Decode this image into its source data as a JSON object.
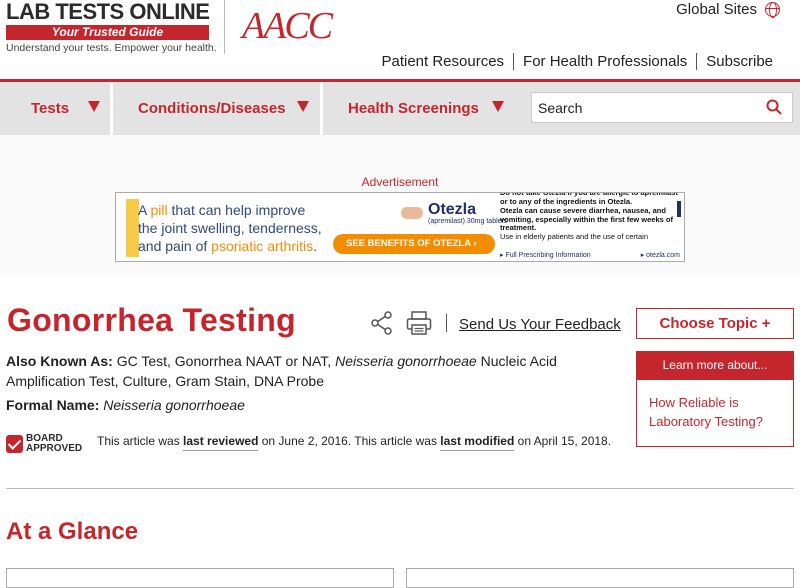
{
  "header": {
    "logo_title": "LAB TESTS ONLINE",
    "logo_guide": "Your Trusted Guide",
    "logo_tagline": "Understand your tests. Empower your health.",
    "aacc_logo": "AACC",
    "global_sites": "Global Sites",
    "top_links": [
      "Patient Resources",
      "For Health Professionals",
      "Subscribe"
    ]
  },
  "nav": {
    "items": [
      "Tests",
      "Conditions/Diseases",
      "Health Screenings"
    ],
    "search_placeholder": "Search"
  },
  "ad": {
    "label": "Advertisement",
    "line1_pre": "A ",
    "line1_hl": "pill",
    "line1_post": " that can help improve",
    "line2": "the joint swelling, tenderness,",
    "line3_pre": "and pain of ",
    "line3_hl": "psoriatic arthritis",
    ".": ".",
    "brand": "Otezla",
    "brand_sub": "(apremilast) 30mg tablets",
    "button": "SEE BENEFITS OF OTEZLA  ›",
    "isi_text": "Do not take Otezla if you are allergic to apremilast or to any of the ingredients in Otezla.",
    "isi_text2": "Otezla can cause severe diarrhea, nausea, and vomiting, especially within the first few weeks of treatment.",
    "isi_text3": "Use in elderly patients and the use of certain",
    "foot_left": "▸ Full Prescribing Information",
    "foot_right": "▸ otezla.com"
  },
  "article": {
    "title": "Gonorrhea Testing",
    "feedback": "Send Us Your Feedback",
    "aka_label": "Also Known As:",
    "aka_text1": " GC Test, Gonorrhea NAAT or NAT, ",
    "aka_italic": "Neisseria gonorrhoeae",
    "aka_text2": " Nucleic Acid Amplification Test, Culture, Gram Stain, DNA Probe",
    "formal_label": "Formal Name:",
    "formal_value": "Neisseria gonorrhoeae",
    "badge_line1": "BOARD",
    "badge_line2": "APPROVED",
    "rev_1": "This article was ",
    "rev_link1": "last reviewed",
    "rev_2": " on June 2, 2016. This article was ",
    "rev_link2": "last modified",
    "rev_3": " on April 15, 2018.",
    "glance": "At a Glance"
  },
  "sidebar": {
    "choose_topic": "Choose Topic +",
    "learn_more": "Learn more about...",
    "learn_link": "How Reliable is Laboratory Testing?"
  },
  "colors": {
    "accent": "#c4262e",
    "nav_bg": "#e3e3e3",
    "ad_orange": "#f28c00"
  }
}
